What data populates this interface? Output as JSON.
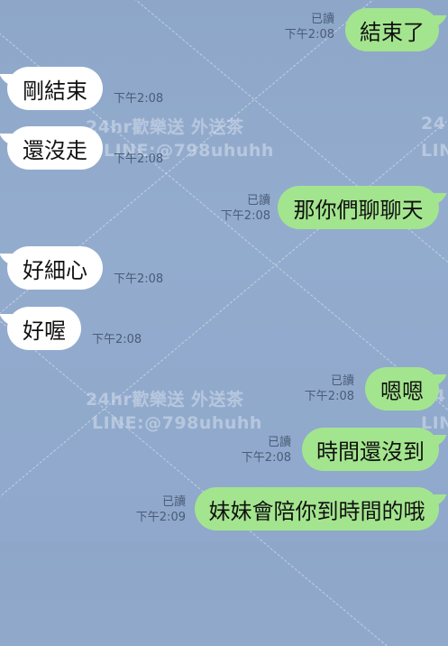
{
  "watermark": {
    "line1": "24hr歡樂送 外送茶",
    "line2": "LINE:@798uhuhh",
    "edge1": "24",
    "edge2": "LIN"
  },
  "messages": [
    {
      "dir": "out",
      "text": "結束了",
      "read": "已讀",
      "time": "下午2:08"
    },
    {
      "dir": "in",
      "text": "剛結束",
      "time": "下午2:08"
    },
    {
      "dir": "in",
      "text": "還沒走",
      "time": "下午2:08"
    },
    {
      "dir": "out",
      "text": "那你們聊聊天",
      "read": "已讀",
      "time": "下午2:08"
    },
    {
      "dir": "in",
      "text": "好細心",
      "time": "下午2:08"
    },
    {
      "dir": "in",
      "text": "好喔",
      "time": "下午2:08"
    },
    {
      "dir": "out",
      "text": "嗯嗯",
      "read": "已讀",
      "time": "下午2:08"
    },
    {
      "dir": "out",
      "text": "時間還沒到",
      "read": "已讀",
      "time": "下午2:08"
    },
    {
      "dir": "out",
      "text": "妹妹會陪你到時間的哦",
      "read": "已讀",
      "time": "下午2:09"
    }
  ]
}
